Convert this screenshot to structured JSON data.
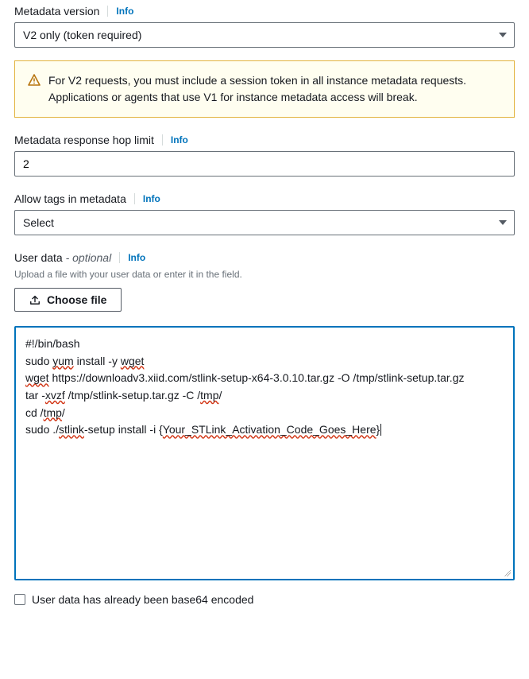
{
  "metadataVersion": {
    "label": "Metadata version",
    "infoLabel": "Info",
    "value": "V2 only (token required)"
  },
  "warning": {
    "text": "For V2 requests, you must include a session token in all instance metadata requests. Applications or agents that use V1 for instance metadata access will break."
  },
  "hopLimit": {
    "label": "Metadata response hop limit",
    "infoLabel": "Info",
    "value": "2"
  },
  "allowTags": {
    "label": "Allow tags in metadata",
    "infoLabel": "Info",
    "value": "Select"
  },
  "userData": {
    "label": "User data",
    "optional": " - optional",
    "infoLabel": "Info",
    "helpText": "Upload a file with your user data or enter it in the field.",
    "chooseFileLabel": "Choose file",
    "script": {
      "line1": "#!/bin/bash",
      "line2a": "sudo ",
      "line2b_err": "yum",
      "line2c": " install -y ",
      "line2d_err": "wget",
      "line3a_err": "wget",
      "line3b": " https://downloadv3.xiid.com/stlink-setup-x64-3.0.10.tar.gz -O /tmp/stlink-setup.tar.gz",
      "line4a": "tar -",
      "line4b_err": "xvzf",
      "line4c": " /tmp/stlink-setup.tar.gz -C /",
      "line4d_err": "tmp",
      "line4e": "/",
      "line5a": "cd /",
      "line5b_err": "tmp",
      "line5c": "/",
      "line6a": "sudo ./",
      "line6b_err": "stlink",
      "line6c": "-setup install -i {",
      "line6d_err": "Your_STLink_Activation_Code_Goes_Here",
      "line6e": "}"
    }
  },
  "base64Checkbox": {
    "label": "User data has already been base64 encoded",
    "checked": false
  }
}
